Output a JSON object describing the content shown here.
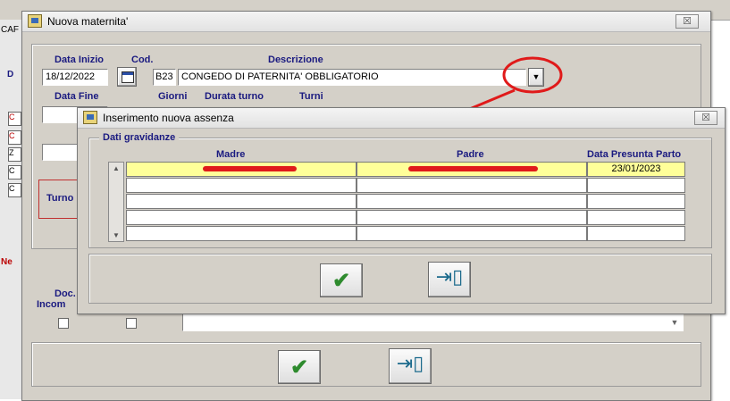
{
  "background": {
    "left_labels": [
      "CAF",
      "D",
      "C",
      "C",
      "Z",
      "C",
      "C",
      "Ne"
    ],
    "turno_label": "Turno",
    "doc_label": "Doc.",
    "incom_label": "Incom"
  },
  "outer_dialog": {
    "title": "Nuova maternita'",
    "close_glyph": "☒",
    "labels": {
      "data_inizio": "Data Inizio",
      "cod": "Cod.",
      "descrizione": "Descrizione",
      "data_fine": "Data Fine",
      "giorni": "Giorni",
      "durata_turno": "Durata turno",
      "turni": "Turni"
    },
    "data_inizio_value": "18/12/2022",
    "cod_value": "B23",
    "descrizione_value": "CONGEDO DI PATERNITA' OBBLIGATORIO",
    "dropdown_glyph": "▼",
    "confirm_icon": "checkmark-icon",
    "exit_icon": "exit-door-icon"
  },
  "inner_dialog": {
    "title": "Inserimento nuova assenza",
    "close_glyph": "☒",
    "group_label": "Dati gravidanze",
    "columns": [
      "Madre",
      "Padre",
      "Data Presunta Parto"
    ],
    "rows": [
      {
        "madre": "",
        "padre": "",
        "data": "23/01/2023"
      },
      {
        "madre": "",
        "padre": "",
        "data": ""
      },
      {
        "madre": "",
        "padre": "",
        "data": ""
      },
      {
        "madre": "",
        "padre": "",
        "data": ""
      },
      {
        "madre": "",
        "padre": "",
        "data": ""
      }
    ],
    "scroll_up": "▲",
    "scroll_down": "▼",
    "confirm_icon": "checkmark-icon",
    "exit_icon": "exit-door-icon"
  },
  "colors": {
    "annotation_red": "#e01a1a",
    "selected_row": "#ffff99",
    "label_blue": "#1a1a80"
  }
}
